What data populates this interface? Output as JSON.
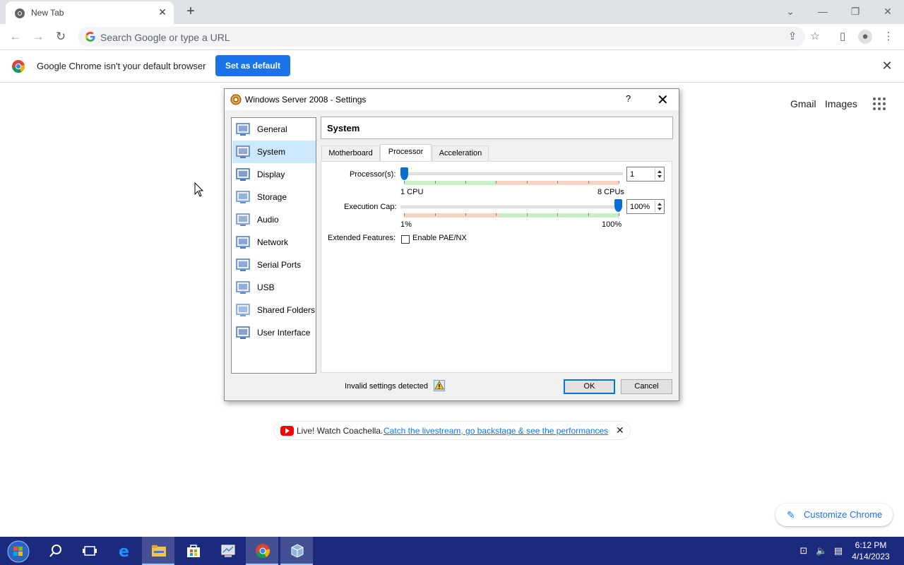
{
  "browser": {
    "tab_title": "New Tab",
    "omnibox_placeholder": "Search Google or type a URL",
    "infobar_message": "Google Chrome isn't your default browser",
    "set_default_label": "Set as default"
  },
  "ntp": {
    "gmail": "Gmail",
    "images": "Images",
    "promo_lead": "Live! Watch Coachella.",
    "promo_link": "Catch the livestream, go backstage & see the performances",
    "customize_label": "Customize Chrome"
  },
  "dialog": {
    "title": "Windows Server 2008 - Settings",
    "help": "?",
    "categories": [
      {
        "label": "General",
        "icon": "monitor-general-icon"
      },
      {
        "label": "System",
        "icon": "chip-system-icon"
      },
      {
        "label": "Display",
        "icon": "display-icon"
      },
      {
        "label": "Storage",
        "icon": "disk-storage-icon"
      },
      {
        "label": "Audio",
        "icon": "speaker-icon"
      },
      {
        "label": "Network",
        "icon": "network-icon"
      },
      {
        "label": "Serial Ports",
        "icon": "serial-port-icon"
      },
      {
        "label": "USB",
        "icon": "usb-icon"
      },
      {
        "label": "Shared Folders",
        "icon": "folder-icon"
      },
      {
        "label": "User Interface",
        "icon": "user-interface-icon"
      }
    ],
    "selected_category": "System",
    "page_title": "System",
    "tabs": [
      "Motherboard",
      "Processor",
      "Acceleration"
    ],
    "active_tab": "Processor",
    "processors_label": "Processor(s):",
    "processors_value": "1",
    "processors_min": "1 CPU",
    "processors_max": "8 CPUs",
    "exec_cap_label": "Execution Cap:",
    "exec_cap_value": "100%",
    "exec_cap_min": "1%",
    "exec_cap_max": "100%",
    "extended_label": "Extended Features:",
    "pae_label": "Enable PAE/NX",
    "pae_checked": false,
    "invalid_text": "Invalid settings detected",
    "ok_label": "OK",
    "cancel_label": "Cancel"
  },
  "taskbar": {
    "time": "6:12 PM",
    "date": "4/14/2023"
  }
}
